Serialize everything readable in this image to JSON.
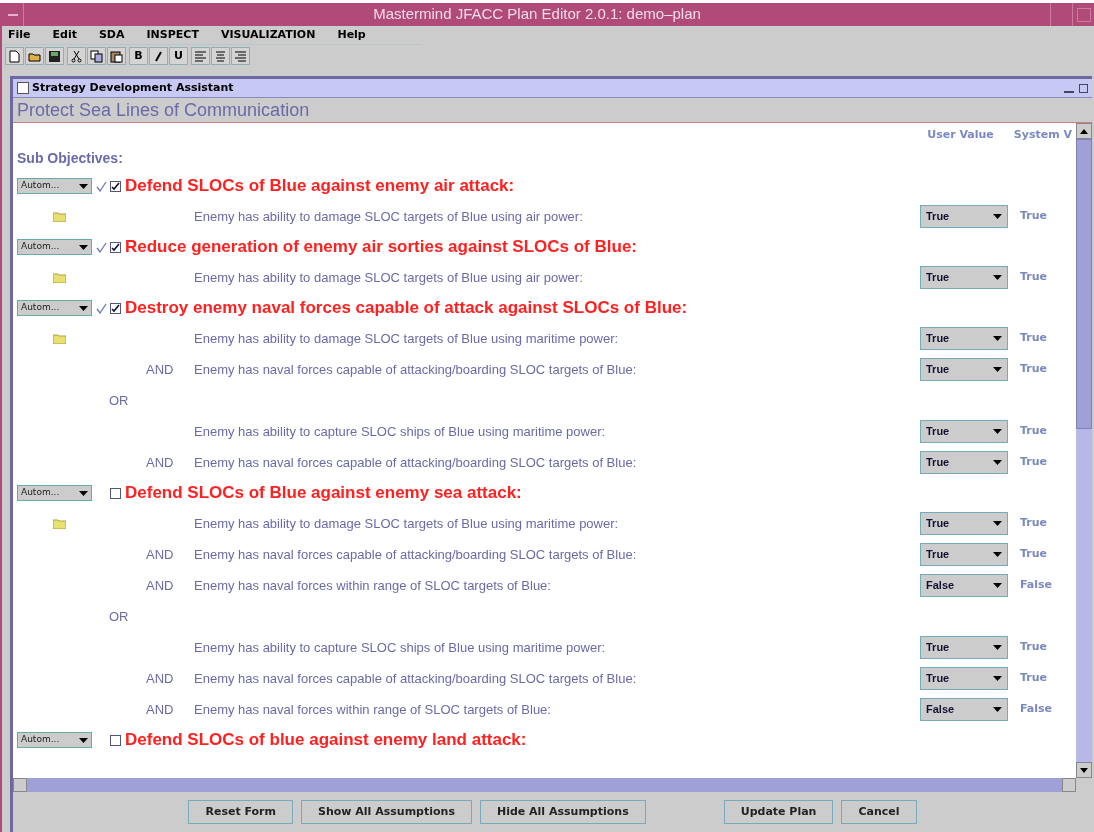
{
  "window": {
    "title": "Mastermind JFACC Plan Editor 2.0.1: demo–plan"
  },
  "menu": [
    "File",
    "Edit",
    "SDA",
    "INSPECT",
    "VISUALIZATION",
    "Help"
  ],
  "toolbar": [
    {
      "kind": "new"
    },
    {
      "kind": "open"
    },
    {
      "kind": "save"
    },
    {
      "kind": "cut"
    },
    {
      "kind": "copy"
    },
    {
      "kind": "paste"
    },
    {
      "kind": "text",
      "label": "B"
    },
    {
      "kind": "italic"
    },
    {
      "kind": "text",
      "label": "U"
    },
    {
      "kind": "align-left"
    },
    {
      "kind": "align-center"
    },
    {
      "kind": "align-right"
    }
  ],
  "panel": {
    "title": "Strategy Development Assistant",
    "heading": "Protect Sea Lines of Communication",
    "columns": [
      "User Value",
      "System V"
    ],
    "section_label": "Sub Objectives:",
    "objectives": [
      {
        "mode": "Autom...",
        "checked": true,
        "title": "Defend SLOCs of Blue against enemy air attack:",
        "rows": [
          {
            "kind": "condition",
            "folder": true,
            "text": "Enemy has ability to damage SLOC targets of Blue using air power:",
            "user_value": "True",
            "system_value": "True"
          }
        ]
      },
      {
        "mode": "Autom...",
        "checked": true,
        "title": "Reduce generation of enemy air sorties against SLOCs of Blue:",
        "rows": [
          {
            "kind": "condition",
            "folder": true,
            "text": "Enemy has ability to damage SLOC targets of Blue using air power:",
            "user_value": "True",
            "system_value": "True"
          }
        ]
      },
      {
        "mode": "Autom...",
        "checked": true,
        "title": "Destroy enemy naval forces capable of attack against SLOCs of Blue:",
        "rows": [
          {
            "kind": "condition",
            "folder": true,
            "text": "Enemy has ability to damage SLOC targets of Blue using maritime power:",
            "user_value": "True",
            "system_value": "True"
          },
          {
            "kind": "condition",
            "connector": "AND",
            "text": "Enemy has naval forces capable of attacking/boarding SLOC targets of Blue:",
            "user_value": "True",
            "system_value": "True"
          },
          {
            "kind": "or",
            "text": "OR"
          },
          {
            "kind": "condition",
            "text": "Enemy has ability to capture SLOC ships of Blue using maritime power:",
            "user_value": "True",
            "system_value": "True"
          },
          {
            "kind": "condition",
            "connector": "AND",
            "text": "Enemy has naval forces capable of attacking/boarding SLOC targets of Blue:",
            "user_value": "True",
            "system_value": "True"
          }
        ]
      },
      {
        "mode": "Autom...",
        "checked": false,
        "title": "Defend SLOCs of Blue against enemy sea attack:",
        "rows": [
          {
            "kind": "condition",
            "folder": true,
            "text": "Enemy has ability to damage SLOC targets of Blue using maritime power:",
            "user_value": "True",
            "system_value": "True"
          },
          {
            "kind": "condition",
            "connector": "AND",
            "text": "Enemy has naval forces capable of attacking/boarding SLOC targets of Blue:",
            "user_value": "True",
            "system_value": "True"
          },
          {
            "kind": "condition",
            "connector": "AND",
            "text": "Enemy has naval forces within range of SLOC targets of Blue:",
            "user_value": "False",
            "system_value": "False"
          },
          {
            "kind": "or",
            "text": "OR"
          },
          {
            "kind": "condition",
            "text": "Enemy has ability to capture SLOC ships of Blue using maritime power:",
            "user_value": "True",
            "system_value": "True"
          },
          {
            "kind": "condition",
            "connector": "AND",
            "text": "Enemy has naval forces capable of attacking/boarding SLOC targets of Blue:",
            "user_value": "True",
            "system_value": "True"
          },
          {
            "kind": "condition",
            "connector": "AND",
            "text": "Enemy has naval forces within range of SLOC targets of Blue:",
            "user_value": "False",
            "system_value": "False"
          }
        ]
      },
      {
        "mode": "Autom...",
        "checked": false,
        "title": "Defend SLOCs of blue against enemy land attack:"
      }
    ]
  },
  "buttons": [
    "Reset Form",
    "Show All Assumptions",
    "Hide All Assumptions",
    "Update Plan",
    "Cancel"
  ]
}
